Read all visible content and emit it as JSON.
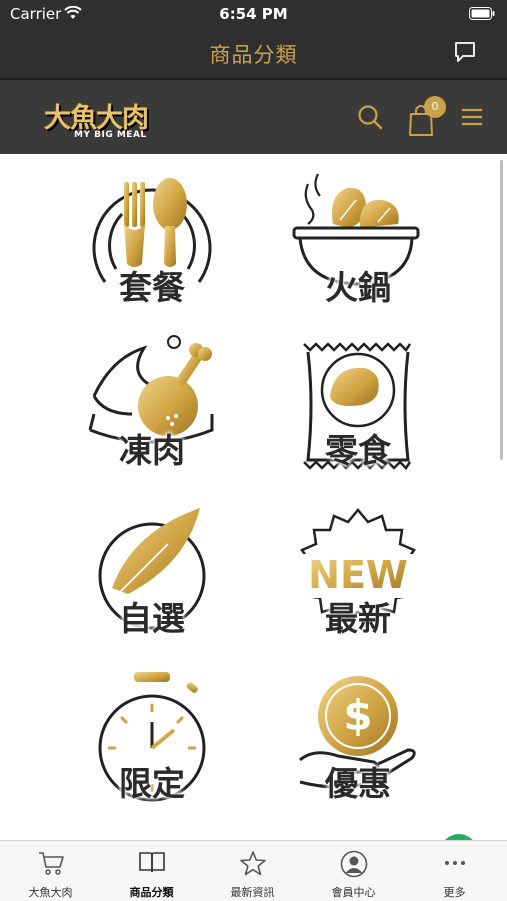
{
  "status_bar": {
    "carrier": "Carrier",
    "time": "6:54 PM"
  },
  "header": {
    "title": "商品分類"
  },
  "site": {
    "logo_text": "大魚大肉",
    "logo_subtext": "MY BIG MEAL",
    "cart_count": "0"
  },
  "categories": [
    {
      "label": "套餐",
      "icon": "fork-spoon-icon"
    },
    {
      "label": "火鍋",
      "icon": "hotpot-icon"
    },
    {
      "label": "凍肉",
      "icon": "chicken-leg-icon"
    },
    {
      "label": "零食",
      "icon": "chips-bag-icon"
    },
    {
      "label": "自選",
      "icon": "feather-icon"
    },
    {
      "label": "最新",
      "icon": "new-badge-icon",
      "badge_text": "NEW"
    },
    {
      "label": "限定",
      "icon": "stopwatch-icon"
    },
    {
      "label": "優惠",
      "icon": "dollar-coin-hand-icon"
    }
  ],
  "tabbar": [
    {
      "label": "大魚大肉",
      "icon": "cart-icon"
    },
    {
      "label": "商品分類",
      "icon": "book-icon",
      "active": true
    },
    {
      "label": "最新資訊",
      "icon": "star-icon"
    },
    {
      "label": "會員中心",
      "icon": "person-icon"
    },
    {
      "label": "更多",
      "icon": "more-icon"
    }
  ],
  "colors": {
    "gold": "#c9a24a",
    "dark_header": "#2f2f2f",
    "site_header": "#3a3a3a"
  }
}
